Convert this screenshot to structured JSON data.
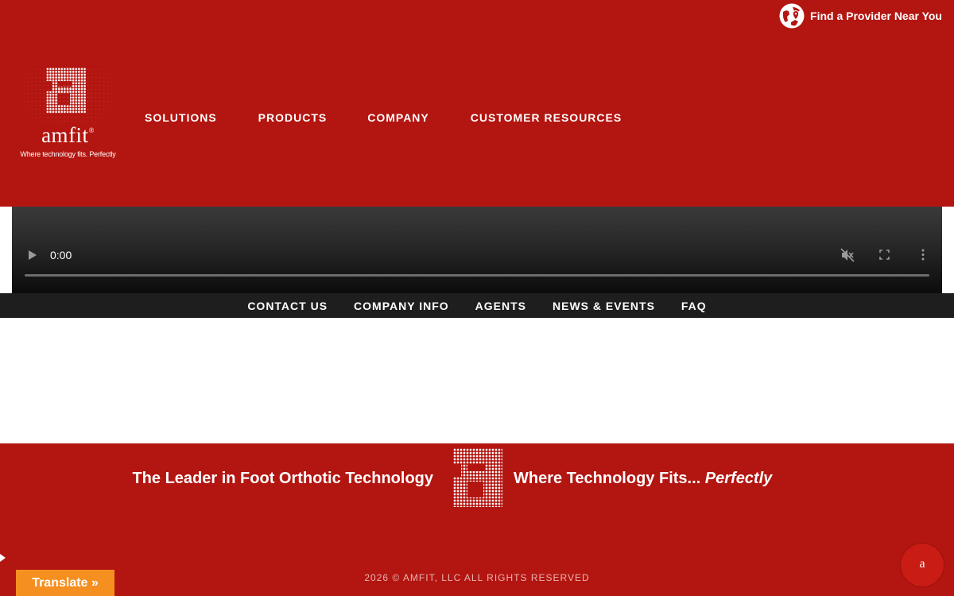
{
  "header": {
    "provider_link": "Find a Provider Near You",
    "logo": {
      "brand": "amfit",
      "trademark": "®",
      "tagline": "Where technology fits. Perfectly"
    },
    "nav": [
      {
        "label": "SOLUTIONS"
      },
      {
        "label": "PRODUCTS"
      },
      {
        "label": "COMPANY"
      },
      {
        "label": "CUSTOMER RESOURCES"
      }
    ]
  },
  "video": {
    "time": "0:00",
    "progress": 0
  },
  "sub_nav": [
    {
      "label": "CONTACT US"
    },
    {
      "label": "COMPANY INFO"
    },
    {
      "label": "AGENTS"
    },
    {
      "label": "NEWS & EVENTS"
    },
    {
      "label": "FAQ"
    }
  ],
  "footer": {
    "slogan_left": "The Leader in Foot Orthotic Technology",
    "slogan_right": "Where Technology Fits...",
    "slogan_right_emphasis": "Perfectly",
    "copyright": "2026 © AMFIT, LLC ALL RIGHTS RESERVED"
  },
  "translate": {
    "label": "Translate »"
  },
  "chat_widget": {
    "letter": "a"
  },
  "colors": {
    "brand_red": "#b31510",
    "dark_bar": "#1e1e1e",
    "translate_orange": "#f58f1f"
  },
  "icons": {
    "provider": "globe-location-icon",
    "play": "play-icon",
    "mute": "muted-speaker-icon",
    "fullscreen": "fullscreen-icon",
    "more": "more-vertical-icon"
  }
}
